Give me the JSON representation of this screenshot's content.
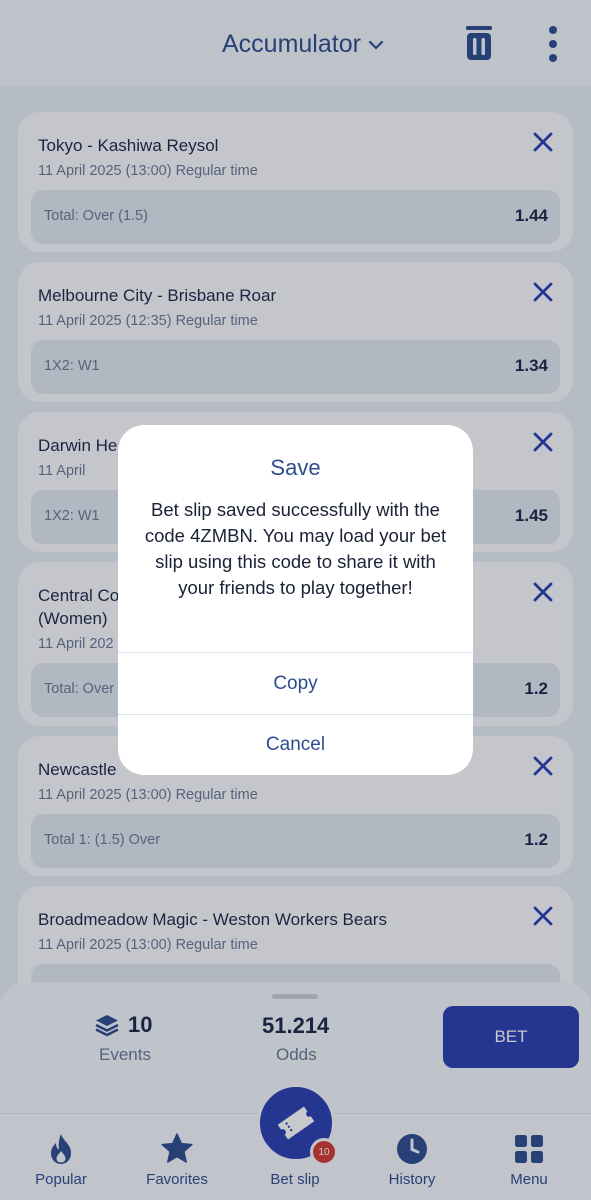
{
  "header": {
    "title": "Accumulator",
    "title_icon": "chevron-down-icon",
    "trash_icon": "trash-icon",
    "more_icon": "more-vertical-icon"
  },
  "bets": [
    {
      "match": "Tokyo - Kashiwa Reysol",
      "time": "11 April 2025 (13:00) Regular time",
      "pick": "Total: Over (1.5)",
      "odd": "1.44"
    },
    {
      "match": "Melbourne City - Brisbane Roar",
      "time": "11 April 2025 (12:35) Regular time",
      "pick": "1X2: W1",
      "odd": "1.34"
    },
    {
      "match": "Darwin Hea",
      "time": "11 April",
      "pick": "1X2: W1",
      "odd": "1.45"
    },
    {
      "match_line1": "Central Coa",
      "match_line2": "(Women)",
      "time": "11 April 202",
      "pick": "Total: Over",
      "odd": "1.2"
    },
    {
      "match": "Newcastle",
      "time": "11 April 2025 (13:00) Regular time",
      "pick": "Total 1: (1.5) Over",
      "odd": "1.2"
    },
    {
      "match": "Broadmeadow Magic - Weston Workers Bears",
      "time": "11 April 2025 (13:00) Regular time"
    }
  ],
  "summary": {
    "events_count": "10",
    "events_label": "Events",
    "odds_value": "51.214",
    "odds_label": "Odds",
    "bet_label": "BET"
  },
  "nav": {
    "popular": "Popular",
    "favorites": "Favorites",
    "betslip": "Bet slip",
    "history": "History",
    "menu": "Menu",
    "betslip_badge": "10"
  },
  "dialog": {
    "title": "Save",
    "message": "Bet slip saved successfully with the code 4ZMBN. You may load your bet slip using this code to share it with your friends to play together!",
    "copy_label": "Copy",
    "cancel_label": "Cancel"
  },
  "colors": {
    "accent": "#2d4d8f",
    "primary_button": "#2b3fb0",
    "badge": "#d63b2e",
    "close_x": "#2b3fb0"
  }
}
